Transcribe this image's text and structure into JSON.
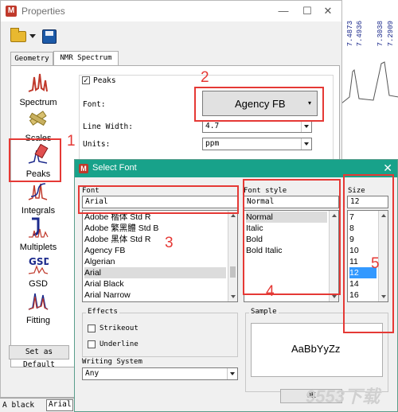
{
  "spectrum_bg": {
    "labels": [
      "7.4873",
      "7.4936",
      "7.3038",
      "7.2909"
    ]
  },
  "properties_window": {
    "title": "Properties",
    "controls": {
      "minimize": "—",
      "maximize": "☐",
      "close": "✕"
    },
    "app_icon_letter": "M",
    "tabs": [
      "Geometry",
      "NMR Spectrum"
    ],
    "nav": [
      {
        "label": "Spectrum",
        "icon": "spectrum-icon"
      },
      {
        "label": "Scales",
        "icon": "scales-icon"
      },
      {
        "label": "Peaks",
        "icon": "peaks-icon"
      },
      {
        "label": "Integrals",
        "icon": "integrals-icon"
      },
      {
        "label": "Multiplets",
        "icon": "multiplets-icon"
      },
      {
        "label": "GSD",
        "icon": "gsd-icon"
      },
      {
        "label": "Fitting",
        "icon": "fitting-icon"
      }
    ],
    "peaks_checkbox_label": "Peaks",
    "font_label": "Font:",
    "font_value": "Agency FB",
    "line_width_label": "Line Width:",
    "line_width_value": "4.7",
    "units_label": "Units:",
    "units_value": "ppm",
    "set_default_label": "Set as Default",
    "bottom_left_text": "A black",
    "bottom_field_text": "Arial"
  },
  "annotations": {
    "n1": "1",
    "n2": "2",
    "n3": "3",
    "n4": "4",
    "n5": "5"
  },
  "select_font": {
    "title": "Select Font",
    "app_icon_letter": "M",
    "close": "✕",
    "font_label": "Font",
    "font_value": "Arial",
    "fonts": [
      "Adobe 楷体 Std R",
      "Adobe 繁黑體 Std B",
      "Adobe 黑体 Std R",
      "Agency FB",
      "Algerian",
      "Arial",
      "Arial Black",
      "Arial Narrow"
    ],
    "style_label": "Font style",
    "style_value": "Normal",
    "styles": [
      "Normal",
      "Italic",
      "Bold",
      "Bold Italic"
    ],
    "size_label": "Size",
    "size_value": "12",
    "sizes": [
      "7",
      "8",
      "9",
      "10",
      "11",
      "12",
      "14",
      "16"
    ],
    "effects_label": "Effects",
    "strikeout_label": "Strikeout",
    "underline_label": "Underline",
    "sample_label": "Sample",
    "sample_text": "AaBbYyZz",
    "writing_system_label": "Writing System",
    "writing_system_value": "Any",
    "ok_label": "OK",
    "watermark": "9553下载"
  }
}
